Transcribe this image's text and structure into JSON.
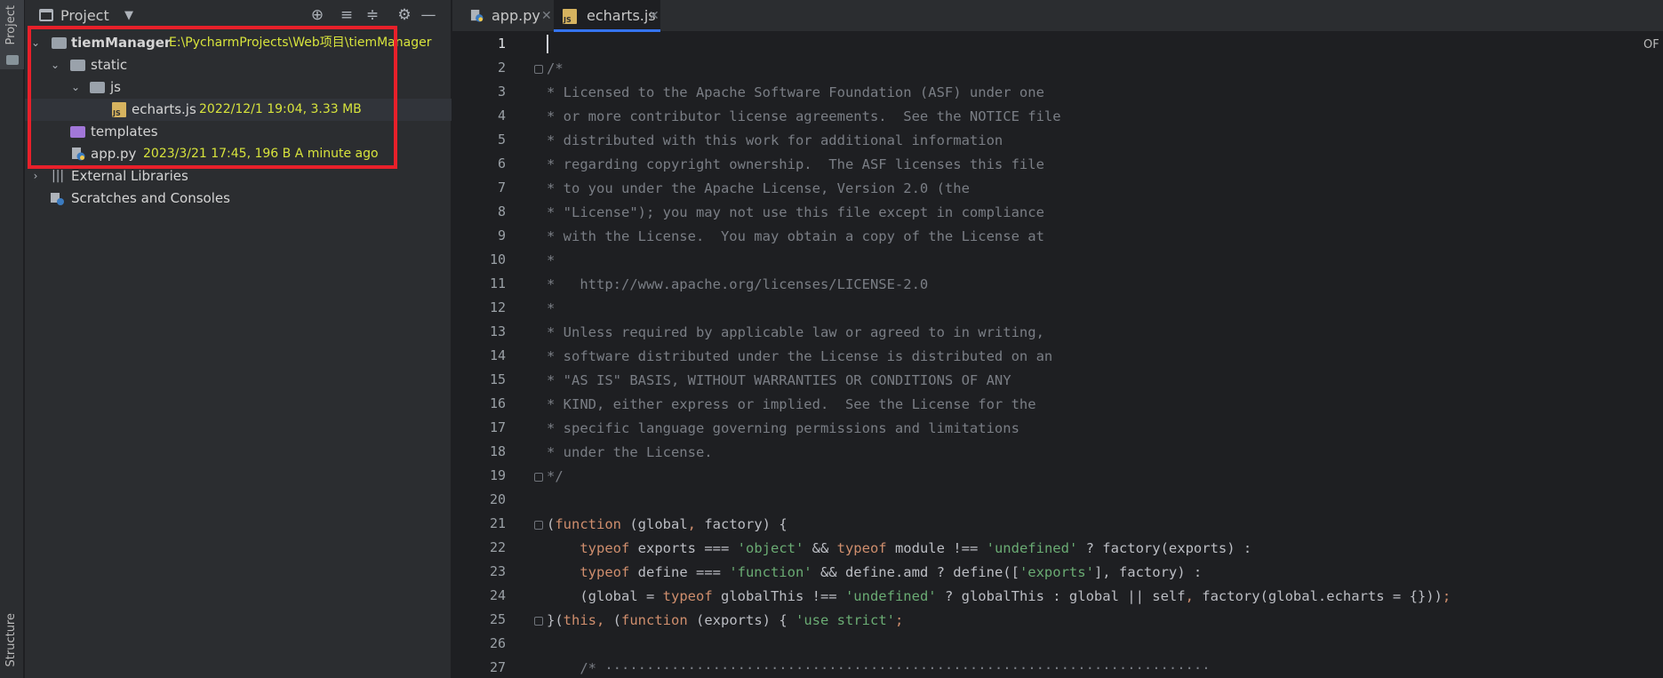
{
  "sidebar_strip": {
    "project_label": "Project",
    "structure_label": "Structure"
  },
  "panel": {
    "title": "Project",
    "tools": [
      "locate-icon",
      "expand-all-icon",
      "collapse-all-icon",
      "settings-icon",
      "hide-icon"
    ]
  },
  "tree": {
    "root_name": "tiemManager",
    "root_path": "E:\\PycharmProjects\\Web项目\\tiemManager",
    "static": "static",
    "js": "js",
    "echarts_name": "echarts.js",
    "echarts_meta": "2022/12/1 19:04, 3.33 MB",
    "templates": "templates",
    "app_name": "app.py",
    "app_meta": "2023/3/21 17:45, 196 B A minute ago",
    "external_libs": "External Libraries",
    "scratches": "Scratches and Consoles"
  },
  "tabs": [
    {
      "label": "app.py",
      "active": false
    },
    {
      "label": "echarts.js",
      "active": true
    }
  ],
  "badge": "OF",
  "colors": {
    "accent": "#3574f0",
    "highlight_box": "#e8202a",
    "meta": "#d7e33c"
  },
  "lines": [
    "1",
    "2",
    "3",
    "4",
    "5",
    "6",
    "7",
    "8",
    "9",
    "10",
    "11",
    "12",
    "13",
    "14",
    "15",
    "16",
    "17",
    "18",
    "19",
    "20",
    "21",
    "22",
    "23",
    "24",
    "25",
    "26",
    "27"
  ],
  "code": {
    "l2": "/*",
    "l3": "* Licensed to the Apache Software Foundation (ASF) under one",
    "l4": "* or more contributor license agreements.  See the NOTICE file",
    "l5": "* distributed with this work for additional information",
    "l6": "* regarding copyright ownership.  The ASF licenses this file",
    "l7": "* to you under the Apache License, Version 2.0 (the",
    "l8": "* \"License\"); you may not use this file except in compliance",
    "l9": "* with the License.  You may obtain a copy of the License at",
    "l10": "*",
    "l11": "*   http://www.apache.org/licenses/LICENSE-2.0",
    "l12": "*",
    "l13": "* Unless required by applicable law or agreed to in writing,",
    "l14": "* software distributed under the License is distributed on an",
    "l15": "* \"AS IS\" BASIS, WITHOUT WARRANTIES OR CONDITIONS OF ANY",
    "l16": "* KIND, either express or implied.  See the License for the",
    "l17": "* specific language governing permissions and limitations",
    "l18": "* under the License.",
    "l19": "*/",
    "l21": {
      "a": "(",
      "b": "function",
      "c": " (global",
      "d": ",",
      "e": " factory) {"
    },
    "l22": {
      "a": "    ",
      "b": "typeof",
      "c": " exports === ",
      "d": "'object'",
      "e": " && ",
      "f": "typeof",
      "g": " module !== ",
      "h": "'undefined'",
      "i": " ? factory(exports) :"
    },
    "l23": {
      "a": "    ",
      "b": "typeof",
      "c": " define === ",
      "d": "'function'",
      "e": " && define.amd ? define([",
      "f": "'exports'",
      "g": "], factory) :"
    },
    "l24": {
      "a": "    (global = ",
      "b": "typeof",
      "c": " globalThis !== ",
      "d": "'undefined'",
      "e": " ? globalThis : global || self",
      "f": ",",
      "g": " factory(global.echarts = {}))",
      "h": ";"
    },
    "l25": {
      "a": "}(",
      "b": "this",
      "c": ", ",
      "d": "(",
      "e": "function",
      "f": " (exports) { ",
      "g": "'use strict'",
      "h": ";"
    },
    "l27": "    /* ·········································································"
  }
}
